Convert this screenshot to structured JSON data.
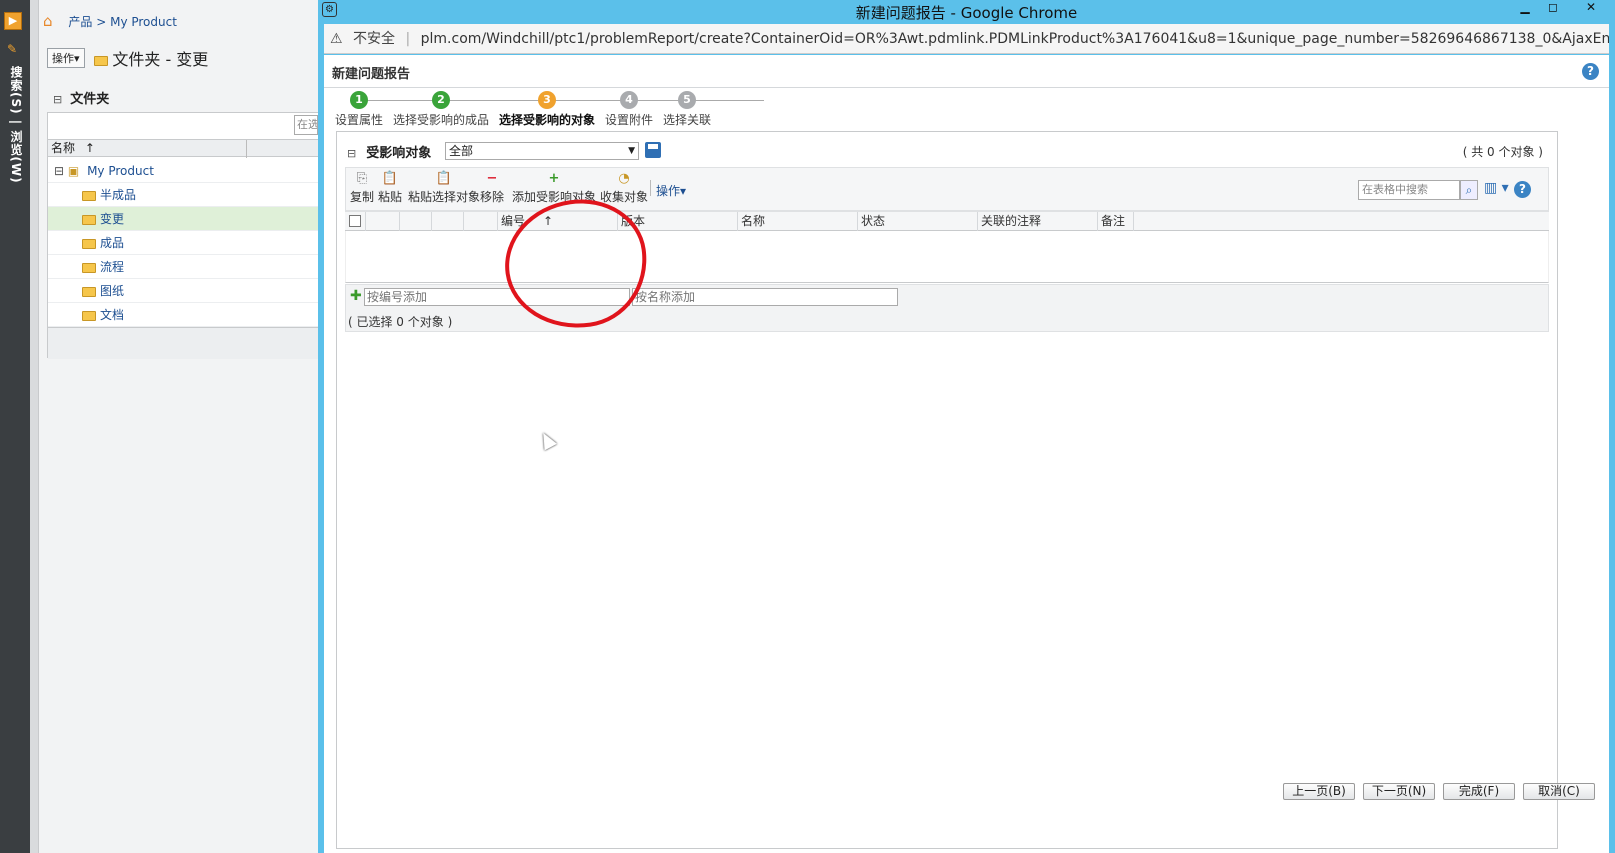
{
  "sidebar_rail": {
    "text": "搜索(S) | 浏览(W)"
  },
  "breadcrumb": {
    "root": "产品",
    "sep": ">",
    "current": "My Product"
  },
  "folder_header": {
    "ops_label": "操作▾",
    "title": "文件夹 - 变更"
  },
  "folder_section": {
    "toggle": "⊟",
    "title": "文件夹",
    "search_placeholder": "在选"
  },
  "folder_table": {
    "column": "名称",
    "sort_indicator": "↑",
    "root": "My Product",
    "items": [
      "半成品",
      "变更",
      "成品",
      "流程",
      "图纸",
      "文档"
    ],
    "selected": "变更"
  },
  "chrome": {
    "title": "新建问题报告 - Google Chrome",
    "insecure": "不安全",
    "url": "plm.com/Windchill/ptc1/problemReport/create?ContainerOid=OR%3Awt.pdmlink.PDMLinkProduct%3A176041&u8=1&unique_page_number=58269646867138_0&AjaxEna..."
  },
  "dialog": {
    "title": "新建问题报告",
    "steps": [
      {
        "num": "1",
        "label": "设置属性",
        "color": "#3aa43a"
      },
      {
        "num": "2",
        "label": "选择受影响的成品",
        "color": "#3aa43a"
      },
      {
        "num": "3",
        "label": "选择受影响的对象",
        "color": "#f0a22e"
      },
      {
        "num": "4",
        "label": "设置附件",
        "color": "#a9abae"
      },
      {
        "num": "5",
        "label": "选择关联",
        "color": "#a9abae"
      }
    ],
    "current_step": 3
  },
  "affected": {
    "toggle": "⊟",
    "title": "受影响对象",
    "filter_value": "全部",
    "count_text": "( 共 0 个对象 )",
    "toolbar": {
      "copy": "复制",
      "paste": "粘贴",
      "paste_selected": "粘贴选择对象",
      "remove": "移除",
      "add_affected": "添加受影响对象",
      "collect": "收集对象",
      "ops": "操作▾"
    },
    "search_placeholder": "在表格中搜索",
    "columns": [
      "编号",
      "版本",
      "名称",
      "状态",
      "关联的注释",
      "备注"
    ],
    "sort_indicator": "↑",
    "add_by_number_placeholder": "按编号添加",
    "add_by_name_placeholder": "按名称添加",
    "selected_text": "( 已选择 0 个对象 )"
  },
  "footer_buttons": {
    "prev": "上一页(B)",
    "next": "下一页(N)",
    "finish": "完成(F)",
    "cancel": "取消(C)"
  },
  "colors": {
    "chrome_frame": "#5bc0ea",
    "rail": "#3a3e41",
    "annotation": "#e0141c",
    "link": "#1d4f91"
  }
}
